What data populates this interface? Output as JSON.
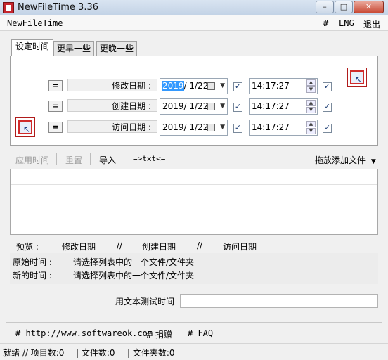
{
  "window": {
    "title": "NewFileTime 3.36",
    "minimize_label": "–",
    "maximize_label": "□",
    "close_label": "✕"
  },
  "menu": {
    "app_name": "NewFileTime",
    "hash": "#",
    "lng": "LNG",
    "exit": "退出"
  },
  "tabs": [
    "设定时间",
    "更早一些",
    "更晚一些"
  ],
  "rows": [
    {
      "eq": "=",
      "label": "修改日期 :",
      "date_year": "2019",
      "date_rest": "/ 1/22",
      "time": "14:17:27"
    },
    {
      "eq": "=",
      "label": "创建日期 :",
      "date_year": "2019",
      "date_rest": "/ 1/22",
      "time": "14:17:27"
    },
    {
      "eq": "=",
      "label": "访问日期 :",
      "date_year": "2019",
      "date_rest": "/ 1/22",
      "time": "14:17:27"
    }
  ],
  "toolbar": {
    "apply": "应用时间",
    "reset": "重置",
    "import": "导入",
    "txt": "=>txt<=",
    "drag_add": "拖放添加文件"
  },
  "preview": {
    "label": "预览 :",
    "modified": "修改日期",
    "sep1": "//",
    "created": "创建日期",
    "sep2": "//",
    "accessed": "访问日期"
  },
  "info": {
    "original_label": "原始时间 :",
    "original_value": "请选择列表中的一个文件/文件夹",
    "new_label": "新的时间 :",
    "new_value": "请选择列表中的一个文件/文件夹"
  },
  "test": {
    "label": "用文本测试时间",
    "value": ""
  },
  "links": {
    "site": "# http://www.softwareok.com",
    "donate": "# 捐赠",
    "faq": "# FAQ"
  },
  "status": {
    "ready": "就绪 // 项目数:0",
    "files": "| 文件数:0",
    "folders": "| 文件夹数:0"
  }
}
